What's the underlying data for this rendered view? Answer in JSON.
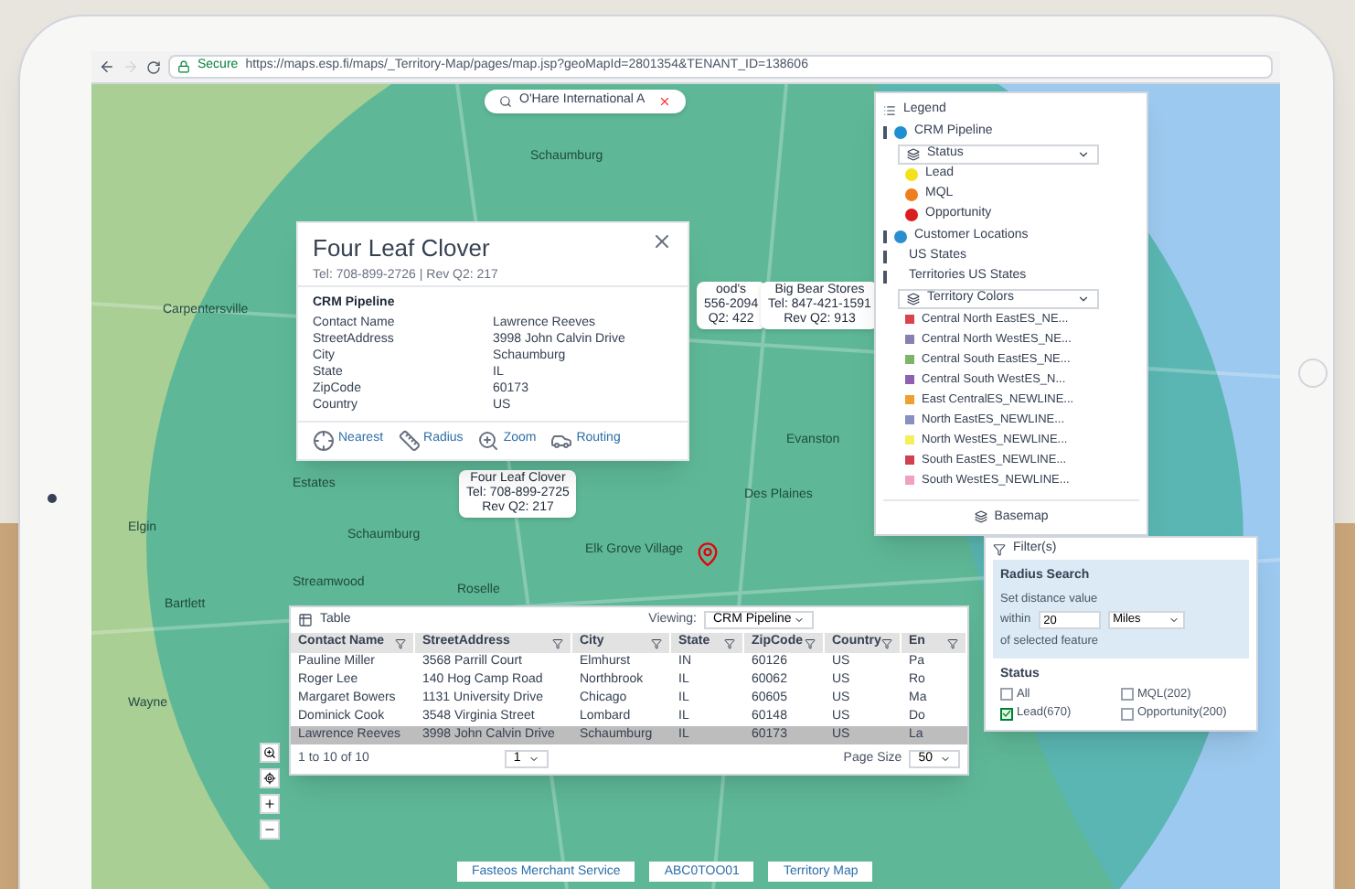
{
  "browser": {
    "secure_label": "Secure",
    "url": "https://maps.esp.fi/maps/_Territory-Map/pages/map.jsp?geoMapId=2801354&TENANT_ID=138606"
  },
  "search": {
    "value": "O'Hare International A"
  },
  "map_labels": [
    "Schaumburg",
    "Des Plaines",
    "Elgin",
    "Carpentersville",
    "Streamwood",
    "Bartlett",
    "Elk Grove Village",
    "Roselle",
    "Evanston",
    "Estates",
    "Wayne",
    "Schaumburg"
  ],
  "markers": [
    {
      "lines": [
        "ood's",
        "556-2094",
        "Q2: 422"
      ]
    },
    {
      "lines": [
        "Big Bear Stores",
        "Tel: 847-421-1591",
        "Rev Q2: 913"
      ]
    },
    {
      "lines": [
        "Four Leaf Clover",
        "Tel: 708-899-2725",
        "Rev Q2: 217"
      ]
    }
  ],
  "popup": {
    "title": "Four Leaf Clover",
    "subtitle": "Tel: 708-899-2726 | Rev Q2: 217",
    "section": "CRM Pipeline",
    "fields": [
      {
        "label": "Contact Name",
        "value": "Lawrence Reeves"
      },
      {
        "label": "StreetAddress",
        "value": "3998 John Calvin Drive"
      },
      {
        "label": "City",
        "value": "Schaumburg"
      },
      {
        "label": "State",
        "value": "IL"
      },
      {
        "label": "ZipCode",
        "value": "60173"
      },
      {
        "label": "Country",
        "value": "US"
      }
    ],
    "actions": [
      {
        "kind": "nearest",
        "label": "Nearest"
      },
      {
        "kind": "radius",
        "label": "Radius"
      },
      {
        "kind": "zoom",
        "label": "Zoom"
      },
      {
        "kind": "routing",
        "label": "Routing"
      }
    ]
  },
  "legend": {
    "title": "Legend",
    "items": [
      {
        "kind": "layer",
        "label": "CRM Pipeline",
        "color": "#1e8fd0"
      },
      {
        "kind": "dropdown",
        "label": "Status"
      },
      {
        "kind": "dot",
        "label": "Lead",
        "color": "#f2e21c"
      },
      {
        "kind": "dot",
        "label": "MQL",
        "color": "#ef7f1a"
      },
      {
        "kind": "dot",
        "label": "Opportunity",
        "color": "#d81e1e"
      },
      {
        "kind": "layer",
        "label": "Customer Locations",
        "color": "#2a8fd0"
      },
      {
        "kind": "plain",
        "label": "US States"
      },
      {
        "kind": "plain",
        "label": "Territories US States"
      },
      {
        "kind": "dropdown",
        "label": "Territory Colors"
      },
      {
        "kind": "swatch",
        "label": "Central North EastES_NE...",
        "color": "#d9434e"
      },
      {
        "kind": "swatch",
        "label": "Central North WestES_NE...",
        "color": "#8a7fb0"
      },
      {
        "kind": "swatch",
        "label": "Central South EastES_NE...",
        "color": "#7bb46a"
      },
      {
        "kind": "swatch",
        "label": "Central South WestES_N...",
        "color": "#9060b0"
      },
      {
        "kind": "swatch",
        "label": "East CentralES_NEWLINE...",
        "color": "#f0a030"
      },
      {
        "kind": "swatch",
        "label": "North EastES_NEWLINE...",
        "color": "#8890c0"
      },
      {
        "kind": "swatch",
        "label": "North WestES_NEWLINE...",
        "color": "#f5ef5a"
      },
      {
        "kind": "swatch",
        "label": "South EastES_NEWLINE...",
        "color": "#d04050"
      },
      {
        "kind": "swatch",
        "label": "South WestES_NEWLINE...",
        "color": "#f0a0c0"
      }
    ],
    "basemap": "Basemap"
  },
  "filter": {
    "title": "Filter(s)",
    "radius_title": "Radius Search",
    "radius_hint": "Set distance value",
    "within": "within",
    "distance": "20",
    "unit": "Miles",
    "of_selected": "of selected feature",
    "status_title": "Status",
    "options": [
      {
        "label": "All",
        "checked": false
      },
      {
        "label": "MQL(202)",
        "checked": false
      },
      {
        "label": "Lead(670)",
        "checked": true
      },
      {
        "label": "Opportunity(200)",
        "checked": false
      }
    ]
  },
  "table": {
    "title": "Table",
    "viewing_label": "Viewing:",
    "viewing": "CRM Pipeline",
    "columns": [
      "Contact Name",
      "StreetAddress",
      "City",
      "State",
      "ZipCode",
      "Country",
      "En"
    ],
    "rows": [
      {
        "cells": [
          "Pauline Miller",
          "3568 Parrill Court",
          "Elmhurst",
          "IN",
          "60126",
          "US",
          "Pa"
        ],
        "selected": false
      },
      {
        "cells": [
          "Roger Lee",
          "140 Hog Camp Road",
          "Northbrook",
          "IL",
          "60062",
          "US",
          "Ro"
        ],
        "selected": false
      },
      {
        "cells": [
          "Margaret Bowers",
          "1131 University Drive",
          "Chicago",
          "IL",
          "60605",
          "US",
          "Ma"
        ],
        "selected": false
      },
      {
        "cells": [
          "Dominick Cook",
          "3548 Virginia Street",
          "Lombard",
          "IL",
          "60148",
          "US",
          "Do"
        ],
        "selected": false
      },
      {
        "cells": [
          "Lawrence Reeves",
          "3998 John Calvin Drive",
          "Schaumburg",
          "IL",
          "60173",
          "US",
          "La"
        ],
        "selected": true
      }
    ],
    "page": "1",
    "page_size_label": "Page Size",
    "page_size": "50",
    "count": "1 to 10 of 10"
  },
  "bottom_strip": [
    "Fasteos Merchant Service",
    "ABC0TOO01",
    "Territory Map"
  ]
}
